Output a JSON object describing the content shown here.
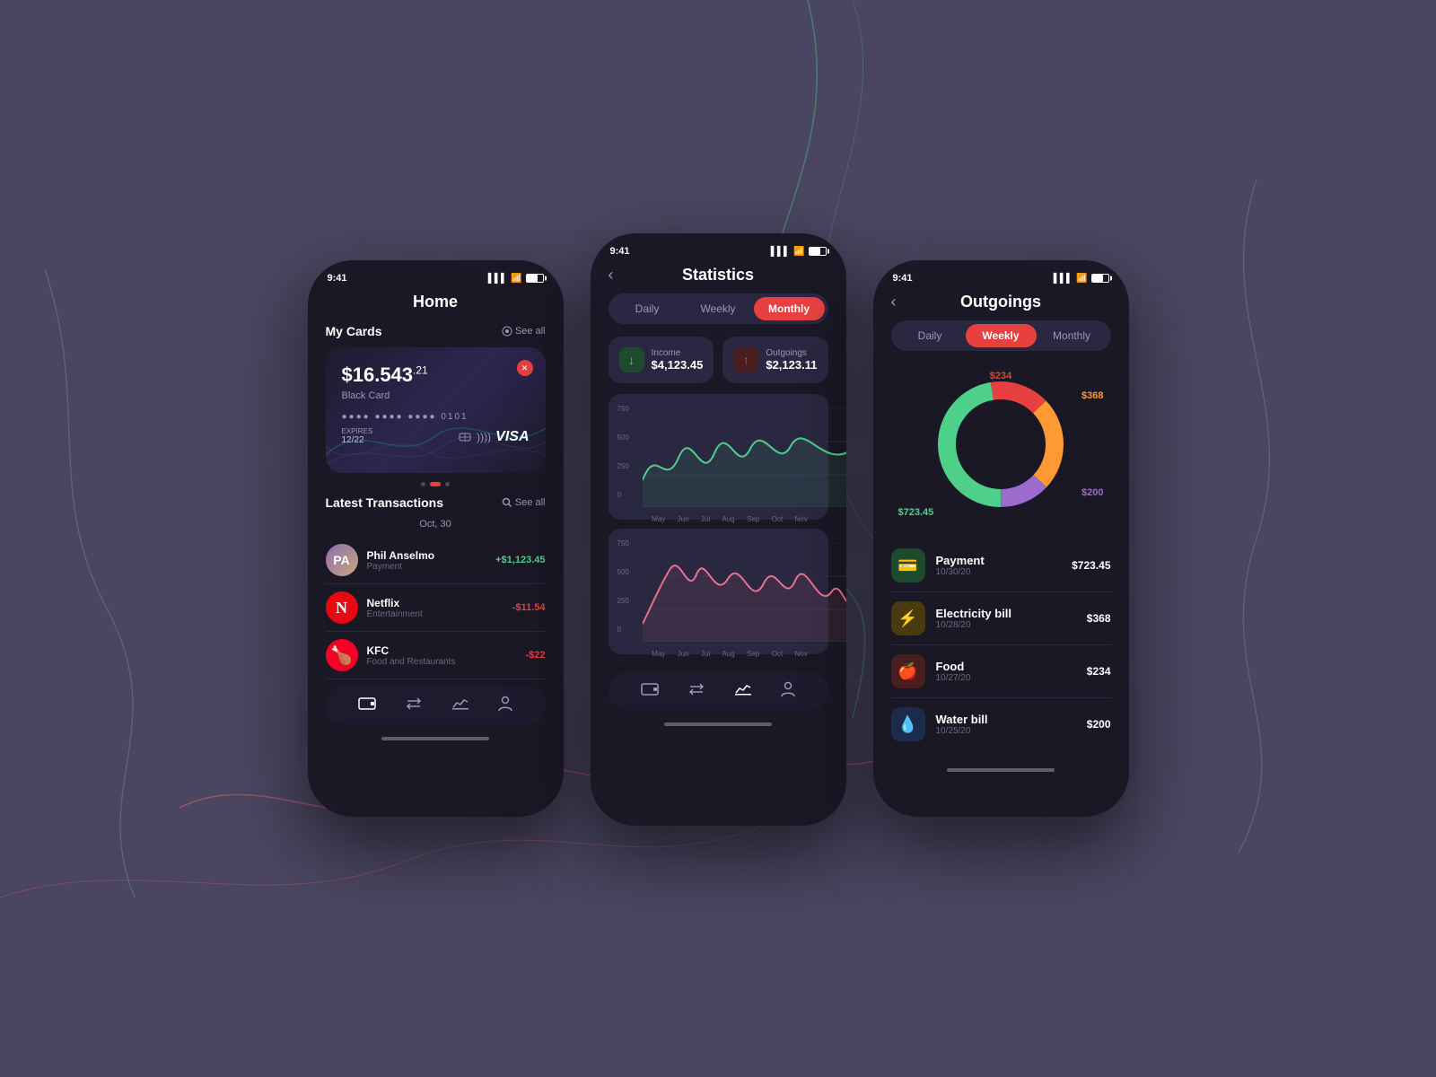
{
  "background": "#4a4560",
  "phones": {
    "left": {
      "time": "9:41",
      "title": "Home",
      "my_cards": {
        "label": "My Cards",
        "see_all": "See all",
        "card": {
          "amount": "$16.543",
          "cents": ".21",
          "type": "Black Card",
          "number": "●●●● ●●●● ●●●● 0101",
          "expiry_label": "EXPIRES",
          "expiry": "12/22",
          "brand": "VISA"
        }
      },
      "latest_transactions": {
        "label": "Latest Transactions",
        "see_all": "See all",
        "date": "Oct, 30",
        "items": [
          {
            "name": "Phil Anselmo",
            "category": "Payment",
            "amount": "+$1,123.45",
            "type": "positive",
            "icon": "person"
          },
          {
            "name": "Netflix",
            "category": "Entertainment",
            "amount": "-$11.54",
            "type": "negative",
            "icon": "netflix"
          },
          {
            "name": "KFC",
            "category": "Food and Restaurants",
            "amount": "-$22",
            "type": "negative",
            "icon": "kfc"
          }
        ]
      },
      "nav": {
        "items": [
          "wallet",
          "transfer",
          "chart",
          "person"
        ]
      }
    },
    "center": {
      "time": "9:41",
      "title": "Statistics",
      "tabs": [
        {
          "label": "Daily",
          "active": false
        },
        {
          "label": "Weekly",
          "active": false
        },
        {
          "label": "Monthly",
          "active": true
        }
      ],
      "income": {
        "label": "Income",
        "value": "$4,123.45"
      },
      "outgoings": {
        "label": "Outgoings",
        "value": "$2,123.11"
      },
      "charts": {
        "income_y_labels": [
          "750",
          "500",
          "250",
          "0"
        ],
        "outgoings_y_labels": [
          "750",
          "500",
          "250",
          "0"
        ],
        "x_labels": [
          "May",
          "Jun",
          "Jul",
          "Aug",
          "Sep",
          "Oct",
          "Nov"
        ]
      }
    },
    "right": {
      "time": "9:41",
      "title": "Outgoings",
      "tabs": [
        {
          "label": "Daily",
          "active": false
        },
        {
          "label": "Weekly",
          "active": true
        },
        {
          "label": "Monthly",
          "active": false
        }
      ],
      "donut": {
        "segments": [
          {
            "label": "$234",
            "color": "#e84040",
            "position": "top"
          },
          {
            "label": "$368",
            "color": "#ff9933",
            "position": "right"
          },
          {
            "label": "$200",
            "color": "#9b6bce",
            "position": "right-bottom"
          },
          {
            "label": "$723.45",
            "color": "#4ecf8a",
            "position": "bottom-left"
          }
        ]
      },
      "items": [
        {
          "name": "Payment",
          "date": "10/30/20",
          "amount": "$723.45",
          "icon": "💳",
          "icon_bg": "#1e4a30",
          "icon_color": "#4ecf8a"
        },
        {
          "name": "Electricity bill",
          "date": "10/28/20",
          "amount": "$368",
          "icon": "⚡",
          "icon_bg": "#4a3a10",
          "icon_color": "#ff9933"
        },
        {
          "name": "Food",
          "date": "10/27/20",
          "amount": "$234",
          "icon": "🍎",
          "icon_bg": "#4a1e1e",
          "icon_color": "#e84040"
        },
        {
          "name": "Water bill",
          "date": "10/25/20",
          "amount": "$200",
          "icon": "💧",
          "icon_bg": "#1e2a4a",
          "icon_color": "#6b9bce"
        }
      ]
    }
  }
}
